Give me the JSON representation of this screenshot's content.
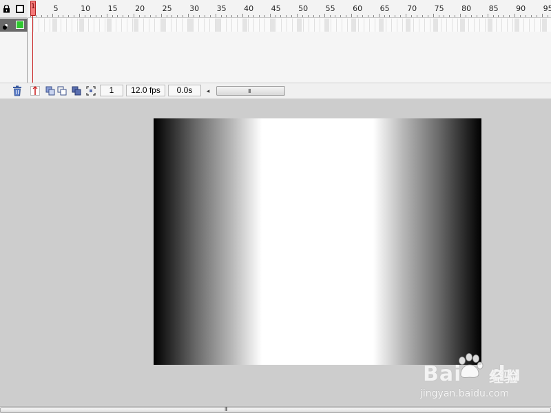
{
  "timeline": {
    "ruler_labels": [
      "1",
      "5",
      "10",
      "15",
      "20",
      "25",
      "30",
      "35",
      "40",
      "45",
      "50",
      "55",
      "60",
      "65",
      "70",
      "75",
      "80",
      "85",
      "90",
      "95"
    ],
    "current_frame_marker": "1",
    "layer_color": "#2ec82e"
  },
  "status_bar": {
    "current_frame": "1",
    "frame_rate": "12.0 fps",
    "elapsed_time": "0.0s",
    "scroll_grip": "III"
  },
  "stage": {
    "gradient_colors": [
      "#000000",
      "#ffffff",
      "#000000"
    ]
  },
  "bottom_scroll": {
    "grip": "III"
  },
  "watermark": {
    "brand": "Bai",
    "brand_suffix": "du",
    "product": "经验",
    "url": "jingyan.baidu.com"
  }
}
